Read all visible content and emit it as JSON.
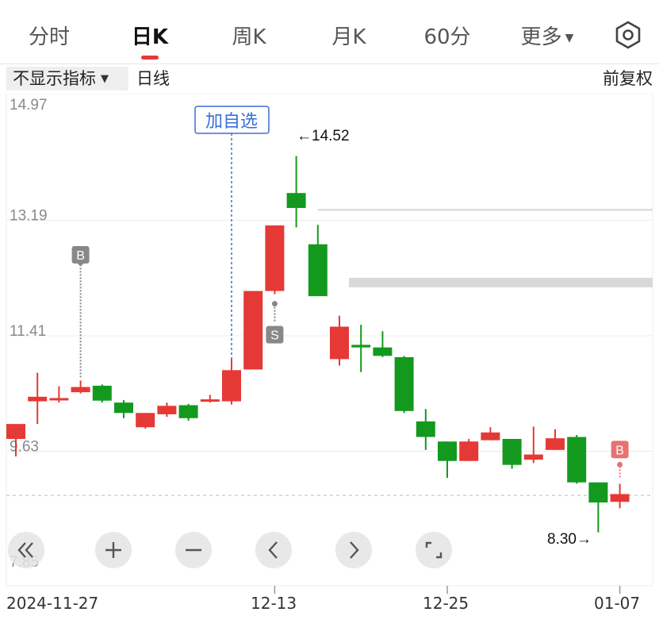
{
  "tabs": [
    {
      "label": "分时",
      "active": false
    },
    {
      "label": "日K",
      "active": true
    },
    {
      "label": "周K",
      "active": false
    },
    {
      "label": "月K",
      "active": false
    },
    {
      "label": "60分",
      "active": false
    },
    {
      "label": "更多",
      "active": false,
      "dropdown": true
    }
  ],
  "toolbar": {
    "indicator_label": "不显示指标",
    "period_label": "日线",
    "adjust_label": "前复权",
    "settings_icon": "hexagon-gear-icon"
  },
  "chart": {
    "y_ticks": [
      "14.97",
      "13.19",
      "11.41",
      "9.63",
      "7.85"
    ],
    "add_watchlist_label": "加自选",
    "high_label": "←14.52",
    "low_label": "8.30→",
    "buy_marker": "B",
    "sell_marker": "S",
    "x_labels": [
      "2024-11-27",
      "12-13",
      "12-25",
      "01-07"
    ],
    "colors": {
      "up": "#e53935",
      "down": "#139a1e",
      "marker_gray": "#888888",
      "marker_red": "#e57373"
    }
  },
  "chart_data": {
    "type": "candlestick",
    "ylim": [
      7.85,
      14.97
    ],
    "y_ticks": [
      14.97,
      13.19,
      11.41,
      9.63,
      7.85
    ],
    "x_labels": [
      "2024-11-27",
      "12-13",
      "12-25",
      "01-07"
    ],
    "high_marker": 14.52,
    "low_marker": 8.3,
    "candles": [
      {
        "o": 9.82,
        "c": 10.05,
        "h": 10.05,
        "l": 9.55
      },
      {
        "o": 10.4,
        "c": 10.47,
        "h": 10.84,
        "l": 10.05
      },
      {
        "o": 10.45,
        "c": 10.45,
        "h": 10.63,
        "l": 10.38
      },
      {
        "o": 10.54,
        "c": 10.62,
        "h": 10.72,
        "l": 10.52
      },
      {
        "o": 10.64,
        "c": 10.41,
        "h": 10.66,
        "l": 10.38
      },
      {
        "o": 10.38,
        "c": 10.22,
        "h": 10.42,
        "l": 10.14
      },
      {
        "o": 10.0,
        "c": 10.22,
        "h": 10.22,
        "l": 9.98
      },
      {
        "o": 10.2,
        "c": 10.33,
        "h": 10.38,
        "l": 10.16
      },
      {
        "o": 10.34,
        "c": 10.14,
        "h": 10.36,
        "l": 10.1
      },
      {
        "o": 10.43,
        "c": 10.43,
        "h": 10.5,
        "l": 10.38
      },
      {
        "o": 10.4,
        "c": 10.88,
        "h": 11.06,
        "l": 10.35
      },
      {
        "o": 10.89,
        "c": 12.1,
        "h": 12.1,
        "l": 10.89
      },
      {
        "o": 12.1,
        "c": 13.11,
        "h": 13.11,
        "l": 12.05
      },
      {
        "o": 13.61,
        "c": 13.38,
        "h": 14.18,
        "l": 13.08
      },
      {
        "o": 12.82,
        "c": 12.02,
        "h": 13.12,
        "l": 12.02
      },
      {
        "o": 11.05,
        "c": 11.55,
        "h": 11.72,
        "l": 10.95
      },
      {
        "o": 11.27,
        "c": 11.23,
        "h": 11.58,
        "l": 10.85
      },
      {
        "o": 11.23,
        "c": 11.1,
        "h": 11.48,
        "l": 11.08
      },
      {
        "o": 11.08,
        "c": 10.25,
        "h": 11.1,
        "l": 10.22
      },
      {
        "o": 10.09,
        "c": 9.85,
        "h": 10.28,
        "l": 9.65
      },
      {
        "o": 9.78,
        "c": 9.48,
        "h": 9.78,
        "l": 9.22
      },
      {
        "o": 9.48,
        "c": 9.78,
        "h": 9.82,
        "l": 9.48
      },
      {
        "o": 9.8,
        "c": 9.92,
        "h": 10.0,
        "l": 9.8
      },
      {
        "o": 9.82,
        "c": 9.42,
        "h": 9.82,
        "l": 9.36
      },
      {
        "o": 9.5,
        "c": 9.58,
        "h": 10.01,
        "l": 9.45
      },
      {
        "o": 9.65,
        "c": 9.83,
        "h": 9.97,
        "l": 9.65
      },
      {
        "o": 9.85,
        "c": 9.15,
        "h": 9.88,
        "l": 9.13
      },
      {
        "o": 9.15,
        "c": 8.84,
        "h": 9.15,
        "l": 8.38
      },
      {
        "o": 8.85,
        "c": 8.97,
        "h": 9.13,
        "l": 8.75
      }
    ],
    "prev_close_line": 8.95,
    "overlay_levels": [
      13.35,
      12.23
    ]
  }
}
